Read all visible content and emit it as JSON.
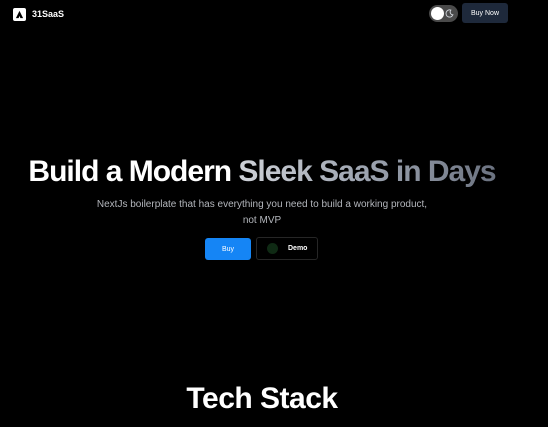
{
  "header": {
    "brand_name": "31SaaS",
    "brand_icon": "logo-mark-icon",
    "theme_toggle": {
      "state": "light",
      "icon": "moon-icon"
    },
    "buy_now_label": "Buy Now"
  },
  "hero": {
    "title_plain": "Build a Modern ",
    "title_highlight": "Sleek SaaS in Days",
    "subtitle": "NextJs boilerplate that has everything you need to build a working product, not MVP",
    "buy_label": "Buy",
    "demo_label": "Demo"
  },
  "tech_stack": {
    "title": "Tech Stack"
  },
  "colors": {
    "background": "#000000",
    "primary_button": "#1585f5",
    "nav_button": "#1e293b",
    "subtitle_text": "#b4b7bd"
  }
}
